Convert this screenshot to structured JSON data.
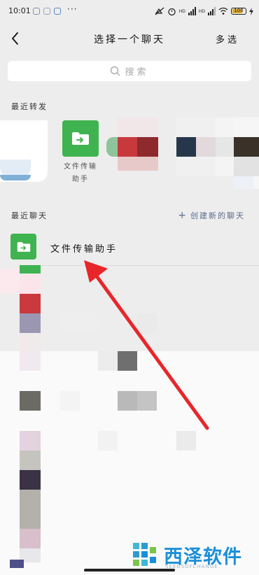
{
  "status_bar": {
    "time": "10:01",
    "dots": "···",
    "hd1": "HD",
    "hd2": "HD",
    "battery": "100"
  },
  "header": {
    "title": "选择一个聊天",
    "multi_select": "多选"
  },
  "search": {
    "placeholder": "搜索"
  },
  "recent_forward": {
    "section_title": "最近转发",
    "items": [
      {
        "label_line1": "文件传输",
        "label_line2": "助手"
      }
    ]
  },
  "recent_chats": {
    "section_title": "最近聊天",
    "create_new": "创建新的聊天",
    "items": [
      {
        "name": "文件传输助手"
      }
    ]
  },
  "watermark": {
    "brand": "西泽软件",
    "sub": "SEEDSOFCHANGE"
  },
  "colors": {
    "accent_green": "#3fb34f",
    "arrow_red": "#e8262a",
    "link_blue": "#5a6c8c",
    "watermark_blue": "#1a8fd8"
  },
  "icons": [
    "back-icon",
    "search-icon",
    "folder-icon",
    "plus-icon"
  ]
}
